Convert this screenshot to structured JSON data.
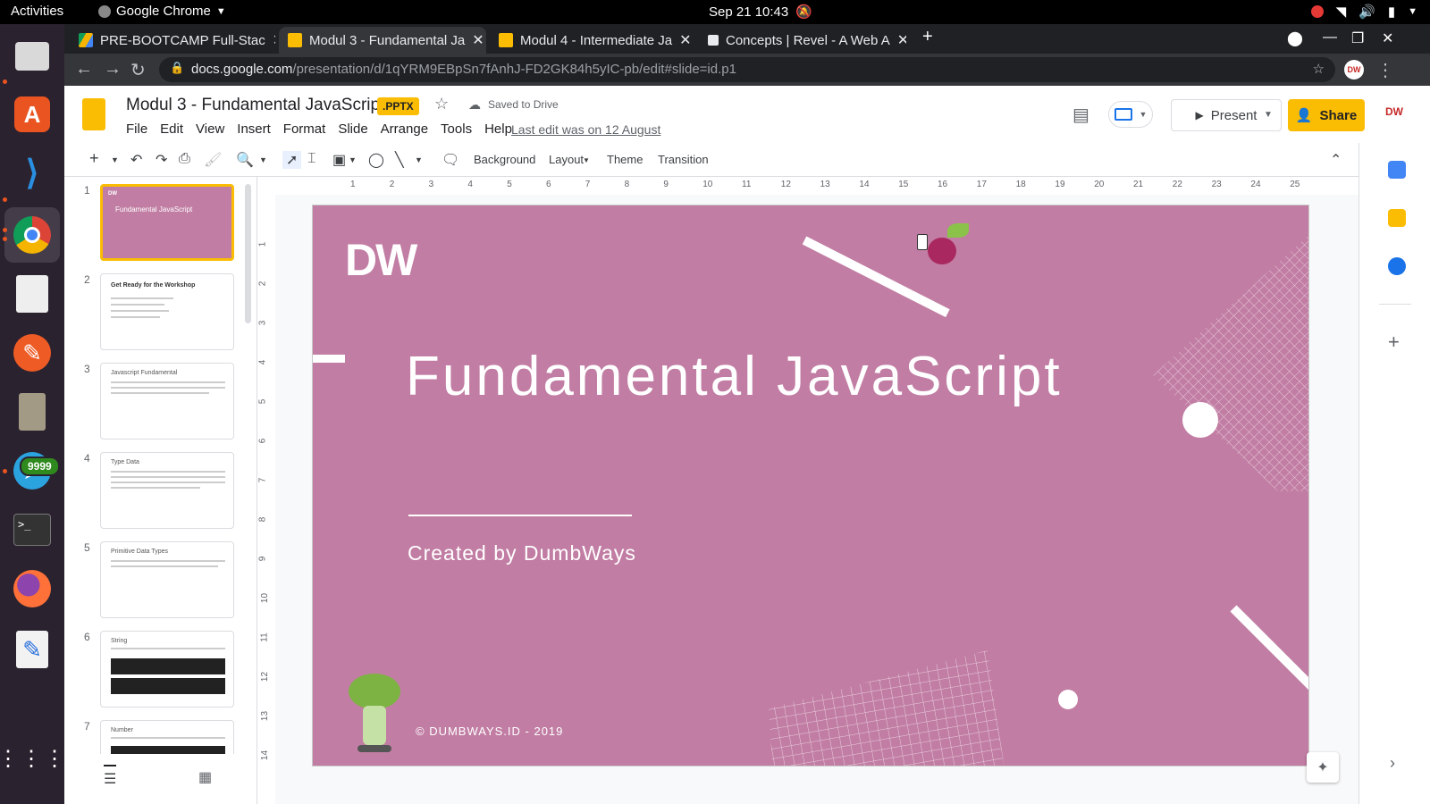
{
  "system": {
    "activities": "Activities",
    "app_name": "Google Chrome",
    "clock": "Sep 21  10:43"
  },
  "dock": {
    "badge": "9999"
  },
  "browser": {
    "tabs": [
      {
        "title": "PRE-BOOTCAMP Full-Stac"
      },
      {
        "title": "Modul 3 - Fundamental Ja"
      },
      {
        "title": "Modul 4 - Intermediate Ja"
      },
      {
        "title": "Concepts | Revel - A Web A"
      }
    ],
    "url_domain": "docs.google.com",
    "url_path": "/presentation/d/1qYRM9EBpSn7fAnhJ-FD2GK84h5yIC-pb/edit#slide=id.p1"
  },
  "slides_app": {
    "title": "Modul 3 - Fundamental JavaScript",
    "file_badge": ".PPTX",
    "saved_status": "Saved to Drive",
    "menu": [
      "File",
      "Edit",
      "View",
      "Insert",
      "Format",
      "Slide",
      "Arrange",
      "Tools",
      "Help"
    ],
    "last_edit": "Last edit was on 12 August",
    "present_label": "Present",
    "share_label": "Share",
    "toolbar": {
      "background": "Background",
      "layout": "Layout",
      "theme": "Theme",
      "transition": "Transition"
    }
  },
  "filmstrip": [
    {
      "num": "1",
      "title": "Fundamental JavaScript"
    },
    {
      "num": "2",
      "title": "Get Ready for the Workshop"
    },
    {
      "num": "3",
      "title": "Javascript Fundamental"
    },
    {
      "num": "4",
      "title": "Type Data"
    },
    {
      "num": "5",
      "title": "Primitive Data Types"
    },
    {
      "num": "6",
      "title": "String"
    },
    {
      "num": "7",
      "title": "Number"
    }
  ],
  "ruler_h": [
    "1",
    "2",
    "3",
    "4",
    "5",
    "6",
    "7",
    "8",
    "9",
    "10",
    "11",
    "12",
    "13",
    "14",
    "15",
    "16",
    "17",
    "18",
    "19",
    "20",
    "21",
    "22",
    "23",
    "24",
    "25"
  ],
  "ruler_v": [
    "1",
    "2",
    "3",
    "4",
    "5",
    "6",
    "7",
    "8",
    "9",
    "10",
    "11",
    "12",
    "13",
    "14"
  ],
  "slide": {
    "logo": "DW",
    "title": "Fundamental JavaScript",
    "subtitle": "Created by DumbWays",
    "footer": "© DUMBWAYS.ID - 2019"
  },
  "colors": {
    "slide_bg": "#c17da3",
    "accent": "#fbbc04",
    "chrome_dark": "#202124"
  }
}
